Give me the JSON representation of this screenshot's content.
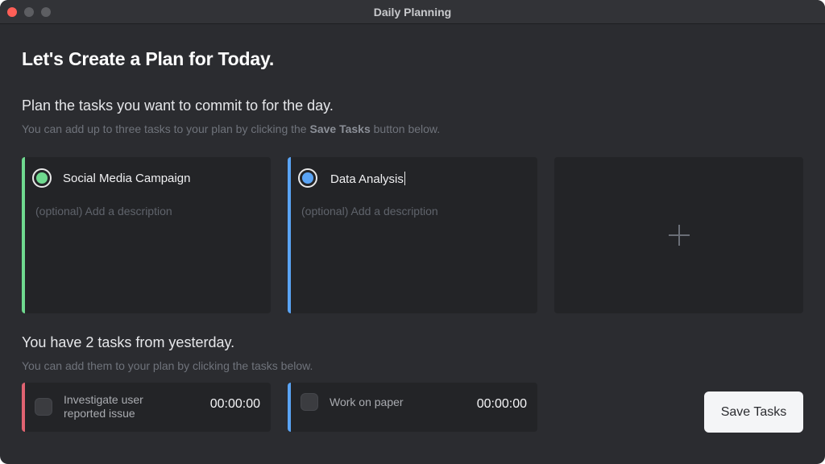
{
  "window": {
    "title": "Daily Planning"
  },
  "heading": "Let's Create a Plan for Today.",
  "plan_section": {
    "title": "Plan the tasks you want to commit to for the day.",
    "subtitle_prefix": "You can add up to three tasks to your plan by clicking the ",
    "subtitle_bold": "Save Tasks",
    "subtitle_suffix": " button below."
  },
  "planned_tasks": [
    {
      "title": "Social Media Campaign",
      "description_placeholder": "(optional) Add a description",
      "color": "#6fd98f"
    },
    {
      "title": "Data Analysis",
      "description_placeholder": "(optional) Add a description",
      "color": "#5aa4f5"
    }
  ],
  "add_task_icon": "plus-icon",
  "yesterday_section": {
    "title": "You have 2 tasks from yesterday.",
    "subtitle": "You can add them to your plan by clicking the tasks below."
  },
  "yesterday_tasks": [
    {
      "title": "Investigate user reported issue",
      "time": "00:00:00",
      "color": "#e06371"
    },
    {
      "title": "Work on paper",
      "time": "00:00:00",
      "color": "#5aa4f5"
    }
  ],
  "save_button_label": "Save Tasks"
}
